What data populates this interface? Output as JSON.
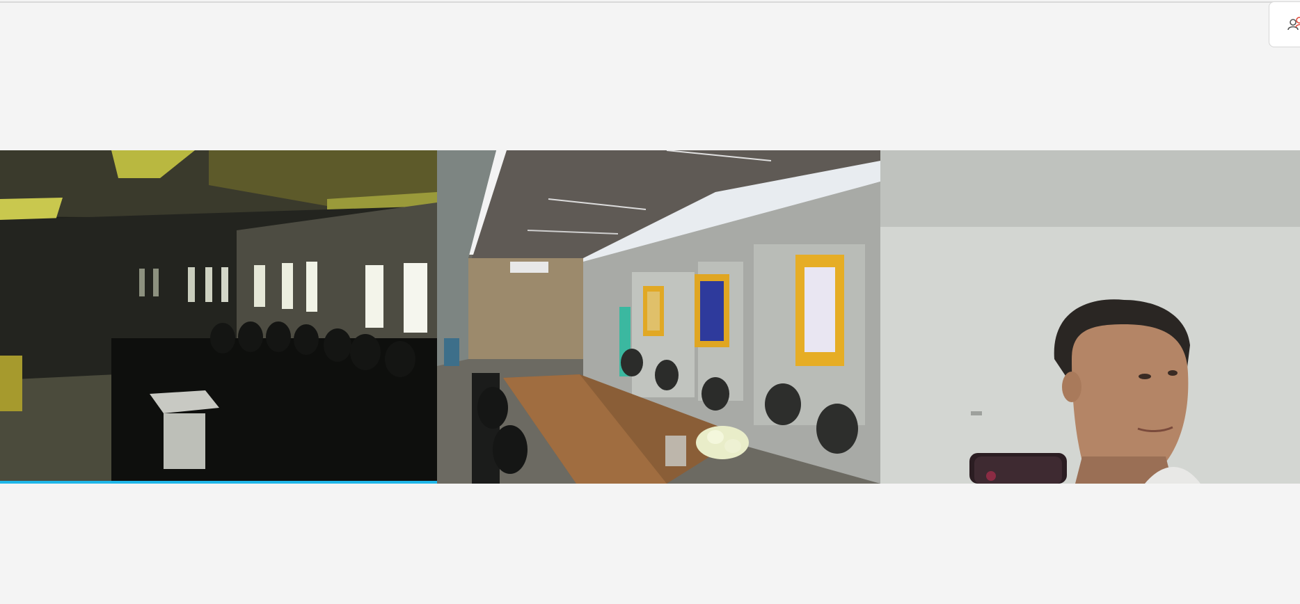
{
  "toolbar": {
    "participants_icon": "participants-icon"
  },
  "video_grid": {
    "tiles": [
      {
        "id": "tile-1",
        "scene": "auditorium",
        "active_speaker": true
      },
      {
        "id": "tile-2",
        "scene": "meeting-room",
        "active_speaker": false
      },
      {
        "id": "tile-3",
        "scene": "webcam-person",
        "active_speaker": false
      }
    ]
  },
  "colors": {
    "background": "#f4f4f4",
    "active_speaker_accent": "#1fb6e8",
    "icon_accent": "#e24a3b"
  }
}
